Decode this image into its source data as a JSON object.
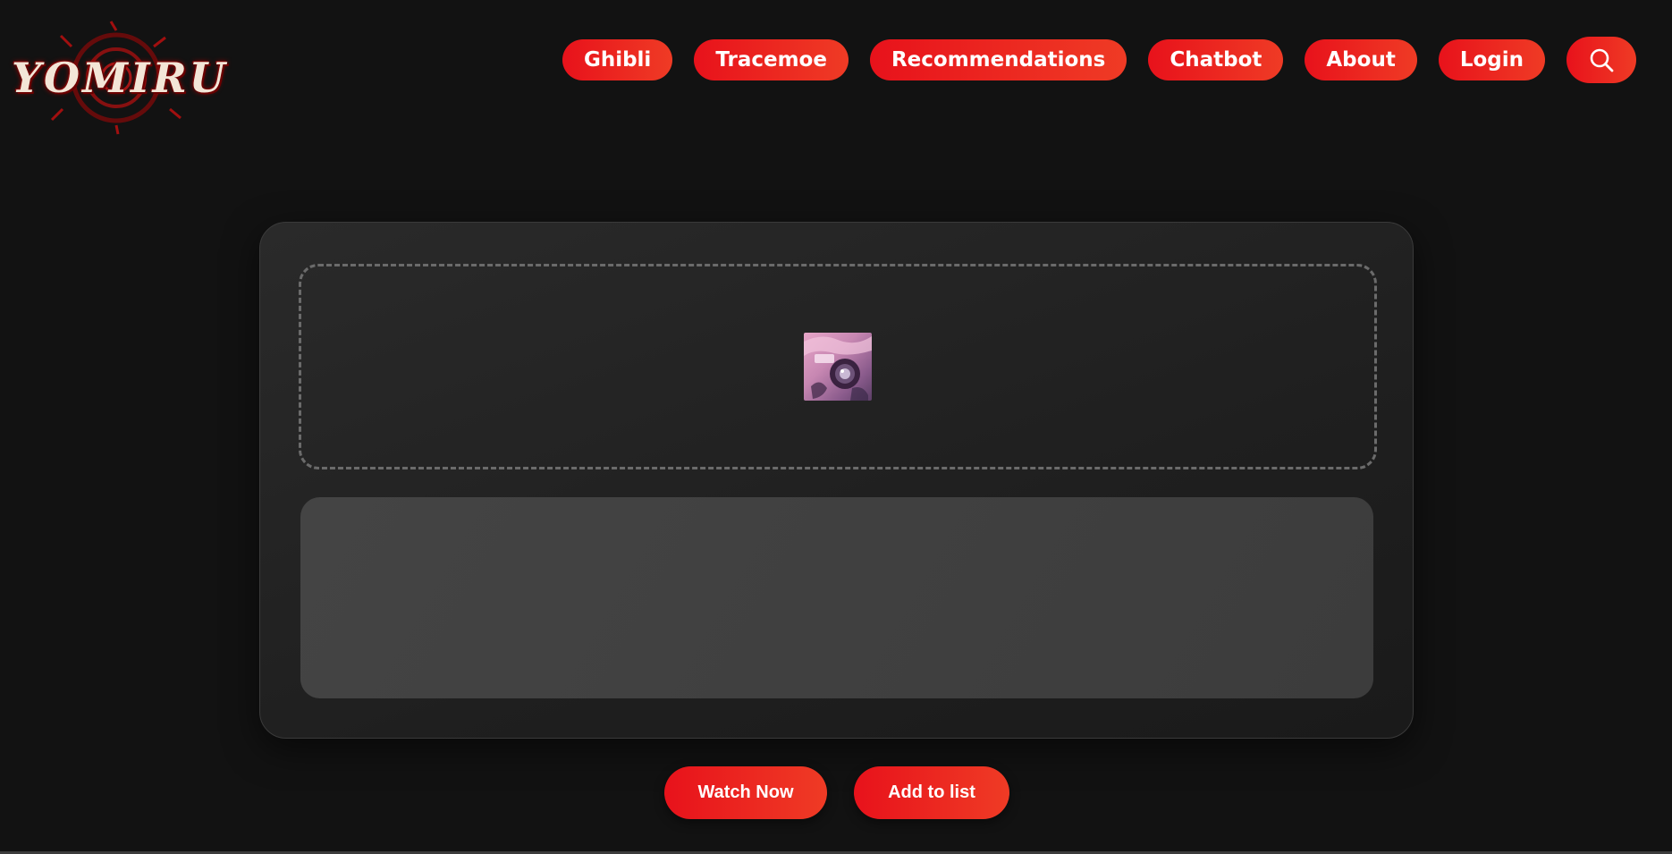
{
  "logo": {
    "text": "YOMIRU",
    "icon": "yomiru-logo"
  },
  "nav": {
    "items": [
      {
        "label": "Ghibli"
      },
      {
        "label": "Tracemoe"
      },
      {
        "label": "Recommendations"
      },
      {
        "label": "Chatbot"
      },
      {
        "label": "About"
      },
      {
        "label": "Login"
      }
    ],
    "search_icon": "search-icon"
  },
  "upload": {
    "thumbnail_icon": "camera-image-thumbnail"
  },
  "actions": {
    "watch_label": "Watch Now",
    "add_label": "Add to list"
  },
  "colors": {
    "background": "#121212",
    "accent_start": "#e8121b",
    "accent_end": "#ef3b25",
    "card": "#262626",
    "result_panel": "#404040"
  }
}
